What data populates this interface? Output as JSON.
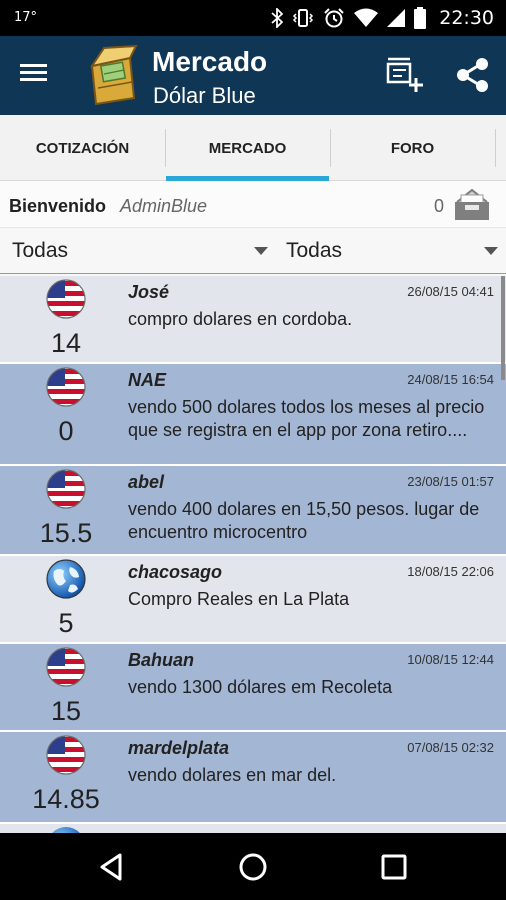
{
  "status_bar": {
    "temperature": "17°",
    "time": "22:30"
  },
  "app_bar": {
    "title": "Mercado",
    "subtitle": "Dólar Blue",
    "actions": [
      "new-post-icon",
      "share-icon"
    ]
  },
  "tabs": [
    {
      "label": "COTIZACIÓN"
    },
    {
      "label": "MERCADO",
      "selected": true
    },
    {
      "label": "FORO"
    }
  ],
  "welcome": {
    "label": "Bienvenido",
    "user": "AdminBlue",
    "count": "0"
  },
  "filters": [
    {
      "value": "Todas"
    },
    {
      "value": "Todas"
    }
  ],
  "colors": {
    "app_bar": "#0f3655",
    "tab_indicator": "#2aa7d9",
    "row_light": "#e2e6ec",
    "row_dark": "#a3b6d3"
  },
  "posts": [
    {
      "user": "José",
      "date": "26/08/15 04:41",
      "text": "compro dolares en cordoba.",
      "score": "14",
      "flag": "usa-flag-icon",
      "style": "light"
    },
    {
      "user": "NAE",
      "date": "24/08/15 16:54",
      "text": "vendo 500 dolares todos los meses al precio que se registra en el app por zona retiro....",
      "score": "0",
      "flag": "usa-flag-icon",
      "style": "dark"
    },
    {
      "user": "abel",
      "date": "23/08/15 01:57",
      "text": "vendo 400 dolares en 15,50 pesos. lugar de encuentro microcentro",
      "score": "15.5",
      "flag": "usa-flag-icon",
      "style": "dark"
    },
    {
      "user": "chacosago",
      "date": "18/08/15 22:06",
      "text": "Compro Reales en La Plata",
      "score": "5",
      "flag": "globe-icon",
      "style": "light"
    },
    {
      "user": "Bahuan",
      "date": "10/08/15 12:44",
      "text": "vendo 1300 dólares em Recoleta",
      "score": "15",
      "flag": "usa-flag-icon",
      "style": "dark"
    },
    {
      "user": "mardelplata",
      "date": "07/08/15 02:32",
      "text": "vendo dolares en mar del.",
      "score": "14.85",
      "flag": "usa-flag-icon",
      "style": "dark"
    }
  ]
}
